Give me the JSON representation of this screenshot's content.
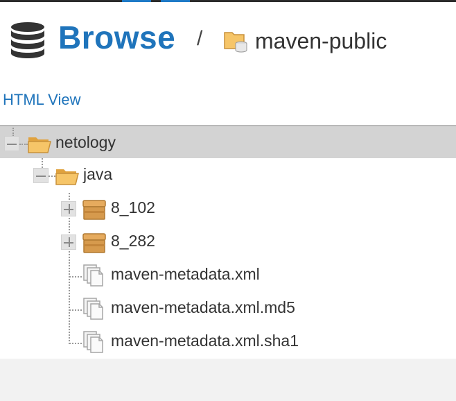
{
  "header": {
    "title": "Browse",
    "separator": "/",
    "repository": "maven-public"
  },
  "links": {
    "html_view": "HTML View"
  },
  "tree": {
    "root": {
      "label": "netology",
      "icon": "folder-open-icon",
      "expanded": true
    },
    "child": {
      "label": "java",
      "icon": "folder-open-icon",
      "expanded": true
    },
    "items": [
      {
        "label": "8_102",
        "icon": "component-box-icon",
        "expandable": true
      },
      {
        "label": "8_282",
        "icon": "component-box-icon",
        "expandable": true
      },
      {
        "label": "maven-metadata.xml",
        "icon": "file-copies-icon",
        "expandable": false
      },
      {
        "label": "maven-metadata.xml.md5",
        "icon": "file-copies-icon",
        "expandable": false
      },
      {
        "label": "maven-metadata.xml.sha1",
        "icon": "file-copies-icon",
        "expandable": false
      }
    ]
  },
  "colors": {
    "accent": "#1f74bb",
    "selected_row": "#d3d3d3",
    "folder": "#f2b64c",
    "box": "#d69a4d"
  }
}
